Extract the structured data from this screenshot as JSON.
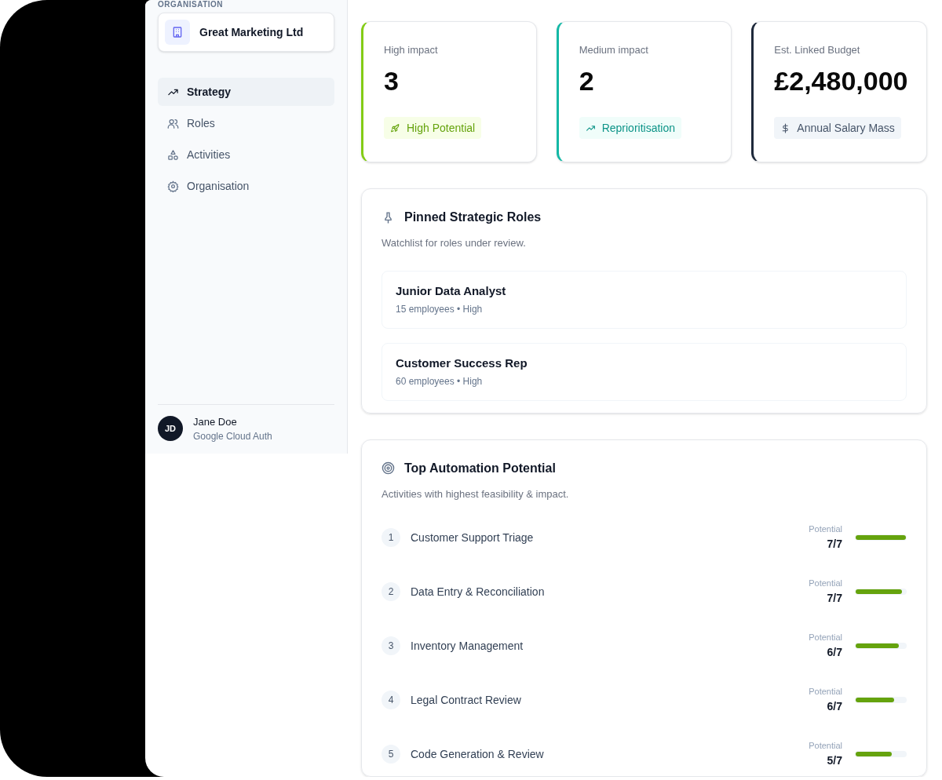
{
  "sidebar": {
    "section_label": "ORGANISATION",
    "organisation": "Great Marketing Ltd",
    "nav": [
      {
        "label": "Strategy",
        "selected": true
      },
      {
        "label": "Roles",
        "selected": false
      },
      {
        "label": "Activities",
        "selected": false
      },
      {
        "label": "Organisation",
        "selected": false
      }
    ],
    "user": {
      "initials": "JD",
      "name": "Jane Doe",
      "subtitle": "Google Cloud Auth"
    }
  },
  "stats": [
    {
      "label": "High impact",
      "value": "3",
      "badge": "High Potential",
      "kind": "high"
    },
    {
      "label": "Medium impact",
      "value": "2",
      "badge": "Reprioritisation",
      "kind": "medium"
    },
    {
      "label": "Est. Linked Budget",
      "value": "£2,480,000",
      "badge": "Annual Salary Mass",
      "kind": "budget"
    }
  ],
  "pinned": {
    "title": "Pinned Strategic Roles",
    "subtitle": "Watchlist for roles under review.",
    "roles": [
      {
        "name": "Junior Data Analyst",
        "meta": "15 employees • High"
      },
      {
        "name": "Customer Success Rep",
        "meta": "60 employees • High"
      }
    ]
  },
  "automation": {
    "title": "Top Automation Potential",
    "subtitle": "Activities with highest feasibility & impact.",
    "items": [
      {
        "rank": "1",
        "name": "Customer Support Triage",
        "label": "Potential",
        "score": "7/7",
        "level": 1
      },
      {
        "rank": "2",
        "name": "Data Entry & Reconciliation",
        "label": "Potential",
        "score": "7/7",
        "level": 0.92
      },
      {
        "rank": "3",
        "name": "Inventory Management",
        "label": "Potential",
        "score": "6/7",
        "level": 0.86
      },
      {
        "rank": "4",
        "name": "Legal Contract Review",
        "label": "Potential",
        "score": "6/7",
        "level": 0.76
      },
      {
        "rank": "5",
        "name": "Code Generation & Review",
        "label": "Potential",
        "score": "5/7",
        "level": 0.72
      }
    ]
  }
}
